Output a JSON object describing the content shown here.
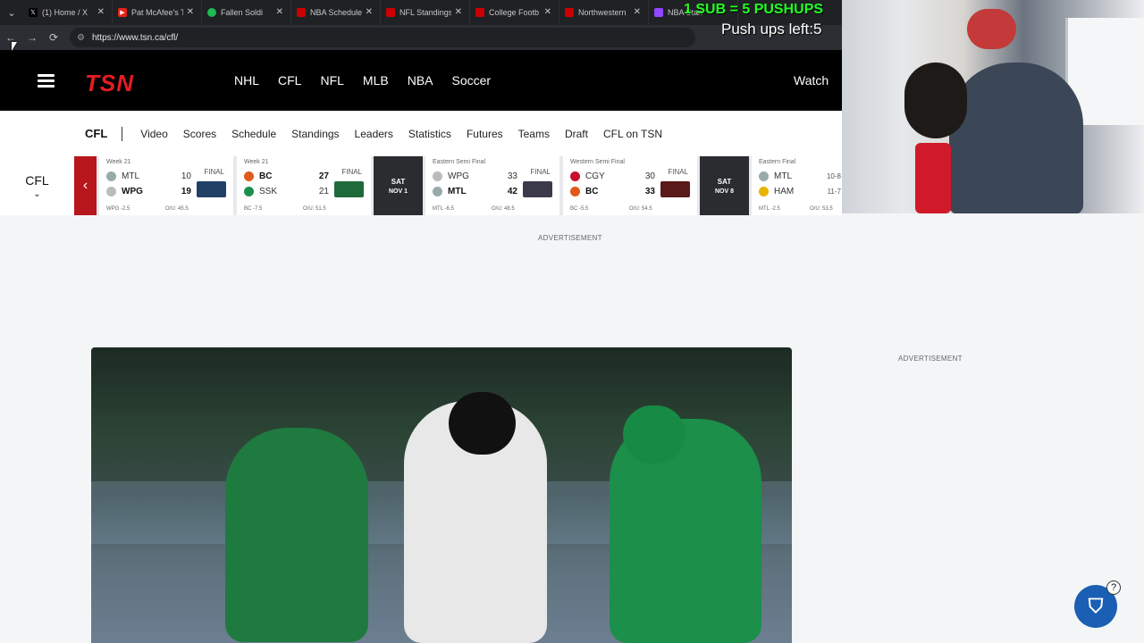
{
  "browser": {
    "tabs": [
      {
        "label": "(1) Home / X",
        "icon": "x-icon",
        "color": "#000000"
      },
      {
        "label": "Pat McAfee's T",
        "icon": "youtube-icon",
        "color": "#e62117"
      },
      {
        "label": "Fallen Soldi",
        "icon": "spotify-icon",
        "color": "#1db954"
      },
      {
        "label": "NBA Schedule",
        "icon": "espn-icon",
        "color": "#cc0000"
      },
      {
        "label": "NFL Standings",
        "icon": "espn-icon",
        "color": "#cc0000"
      },
      {
        "label": "College Footb",
        "icon": "espn-icon",
        "color": "#cc0000"
      },
      {
        "label": "Northwestern",
        "icon": "espn-icon",
        "color": "#cc0000"
      },
      {
        "label": "NBA Stan",
        "icon": "twitch-icon",
        "color": "#9146ff"
      }
    ],
    "url": "https://www.tsn.ca/cfl/"
  },
  "overlay": {
    "title": "1 SUB = 5 PUSHUPS",
    "counter": "Push ups left:5"
  },
  "header": {
    "logo": "TSN",
    "nav": [
      "NHL",
      "CFL",
      "NFL",
      "MLB",
      "NBA",
      "Soccer"
    ],
    "watch": "Watch"
  },
  "subnav": {
    "section": "CFL",
    "items": [
      "Video",
      "Scores",
      "Schedule",
      "Standings",
      "Leaders",
      "Statistics",
      "Futures",
      "Teams",
      "Draft",
      "CFL on TSN"
    ]
  },
  "scores": {
    "league": "CFL",
    "games": [
      {
        "label": "Week 21",
        "status": "FINAL",
        "away": "MTL",
        "away_score": "10",
        "home": "WPG",
        "home_score": "19",
        "winner": "home",
        "line": "WPG -2.5",
        "ou": "O/U: 45.5"
      },
      {
        "label": "Week 21",
        "status": "FINAL",
        "away": "BC",
        "away_score": "27",
        "home": "SSK",
        "home_score": "21",
        "winner": "away",
        "line": "BC -7.5",
        "ou": "O/U: 51.5"
      },
      {
        "label": "Eastern Semi Final",
        "status": "FINAL",
        "away": "WPG",
        "away_score": "33",
        "home": "MTL",
        "home_score": "42",
        "winner": "home",
        "line": "MTL -6.5",
        "ou": "O/U: 48.5"
      },
      {
        "label": "Western Semi Final",
        "status": "FINAL",
        "away": "CGY",
        "away_score": "30",
        "home": "BC",
        "home_score": "33",
        "winner": "home",
        "line": "BC -5.5",
        "ou": "O/U: 54.5"
      },
      {
        "label": "Eastern Final",
        "status": "",
        "away": "MTL",
        "away_score": "10-8",
        "home": "HAM",
        "home_score": "11-7",
        "winner": "",
        "line": "MTL -2.5",
        "ou": "O/U: 53.5"
      }
    ],
    "dates": [
      {
        "day": "SAT",
        "date": "NOV 1"
      },
      {
        "day": "SAT",
        "date": "NOV 8"
      }
    ]
  },
  "ads": {
    "label": "ADVERTISEMENT"
  },
  "help": "?"
}
